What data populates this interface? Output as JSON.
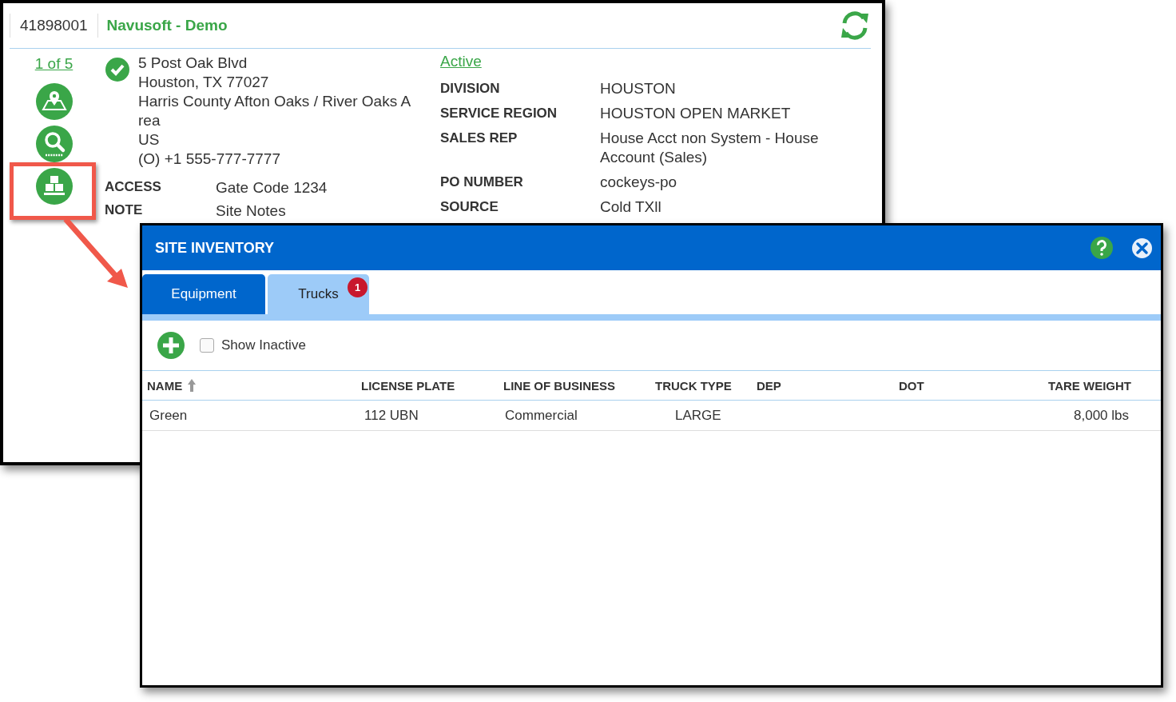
{
  "record_window": {
    "account_number": "41898001",
    "title": "Navusoft - Demo",
    "pager": "1 of 5",
    "address_lines": [
      "5 Post Oak Blvd",
      "Houston, TX 77027",
      "Harris County Afton Oaks / River Oaks A",
      "rea",
      "US",
      "(O) +1 555-777-7777"
    ],
    "status": "Active",
    "details": [
      {
        "label": "DIVISION",
        "value": "HOUSTON"
      },
      {
        "label": "SERVICE REGION",
        "value": "HOUSTON OPEN MARKET"
      },
      {
        "label": "SALES REP",
        "value": "House Acct non System - House Account (Sales)"
      },
      {
        "label": "PO NUMBER",
        "value": "cockeys-po"
      },
      {
        "label": "SOURCE",
        "value": "Cold TXll"
      }
    ],
    "site_fields": [
      {
        "label": "ACCESS",
        "value": "Gate Code 1234"
      },
      {
        "label": "NOTE",
        "value": "Site Notes"
      }
    ]
  },
  "dialog": {
    "title": "SITE INVENTORY",
    "tabs": [
      {
        "label": "Equipment",
        "selected": false
      },
      {
        "label": "Trucks",
        "selected": true,
        "badge": "1"
      }
    ],
    "show_inactive": {
      "label": "Show Inactive",
      "checked": false
    },
    "table": {
      "columns": [
        {
          "label": "NAME",
          "sorted": true
        },
        {
          "label": "LICENSE PLATE",
          "sorted": false
        },
        {
          "label": "LINE OF BUSINESS",
          "sorted": false
        },
        {
          "label": "TRUCK TYPE",
          "sorted": false
        },
        {
          "label": "DEP",
          "sorted": false
        },
        {
          "label": "DOT",
          "sorted": false
        },
        {
          "label": "TARE WEIGHT",
          "sorted": false
        }
      ],
      "rows": [
        [
          "Green",
          "112 UBN",
          "Commercial",
          "LARGE",
          "",
          "",
          "8,000 lbs"
        ]
      ]
    }
  }
}
